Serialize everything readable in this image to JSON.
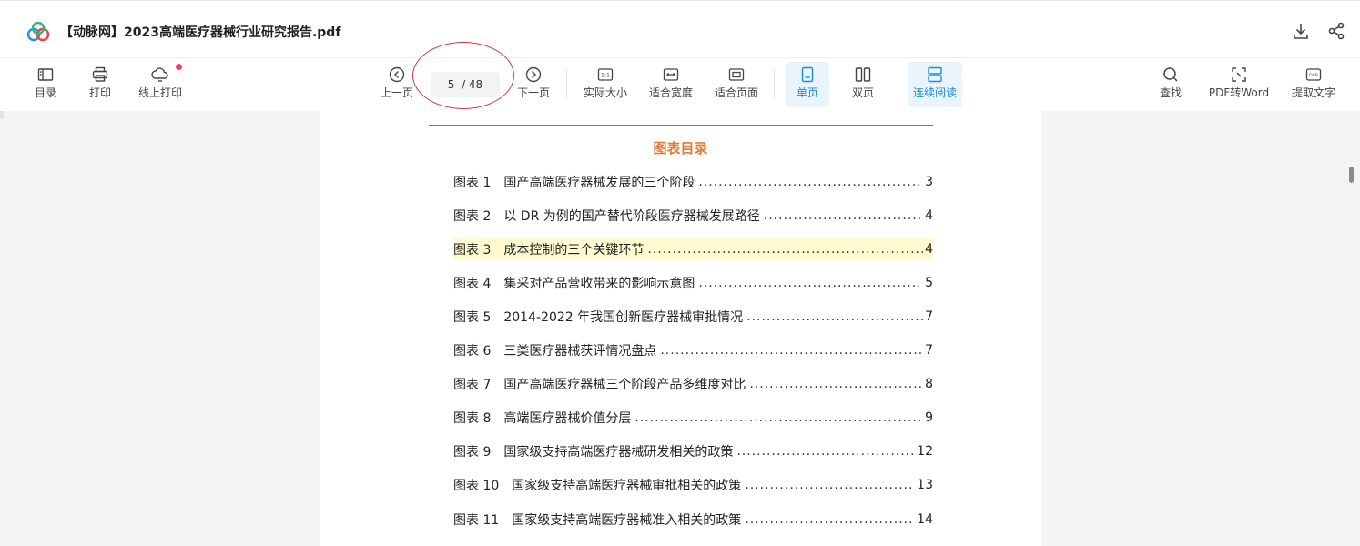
{
  "header": {
    "title": "【动脉网】2023高端医疗器械行业研究报告.pdf",
    "logo_icon": "cloud-logo-icon",
    "actions": [
      {
        "icon": "download-icon"
      },
      {
        "icon": "share-icon"
      }
    ]
  },
  "toolbar": {
    "left": [
      {
        "label": "目录",
        "icon": "toc-icon"
      },
      {
        "label": "打印",
        "icon": "printer-icon"
      },
      {
        "label": "线上打印",
        "icon": "cloud-print-icon"
      }
    ],
    "prev_label": "上一页",
    "next_label": "下一页",
    "page_current": "5",
    "page_total": "/ 48",
    "view": [
      {
        "label": "实际大小",
        "icon": "actual-size-icon"
      },
      {
        "label": "适合宽度",
        "icon": "fit-width-icon"
      },
      {
        "label": "适合页面",
        "icon": "fit-page-icon"
      }
    ],
    "layout": [
      {
        "label": "单页",
        "icon": "single-page-icon",
        "active": true
      },
      {
        "label": "双页",
        "icon": "double-page-icon",
        "active": false
      },
      {
        "label": "连续阅读",
        "icon": "continuous-icon",
        "active": true
      }
    ],
    "right": [
      {
        "label": "查找",
        "icon": "search-icon"
      },
      {
        "label": "PDF转Word",
        "icon": "convert-icon"
      },
      {
        "label": "提取文字",
        "icon": "ocr-icon"
      }
    ],
    "accent_color": "#1e8bd6"
  },
  "document": {
    "toc_title": "图表目录",
    "toc_title_color": "#e07a3a",
    "entries": [
      {
        "label": "图表 1",
        "text": "国产高端医疗器械发展的三个阶段",
        "page": "3"
      },
      {
        "label": "图表 2",
        "text": "以 DR 为例的国产替代阶段医疗器械发展路径",
        "page": "4"
      },
      {
        "label": "图表 3",
        "text": "成本控制的三个关键环节",
        "page": "4",
        "highlight": true
      },
      {
        "label": "图表 4",
        "text": "集采对产品营收带来的影响示意图",
        "page": "5"
      },
      {
        "label": "图表 5",
        "text": "2014-2022 年我国创新医疗器械审批情况",
        "page": "7"
      },
      {
        "label": "图表 6",
        "text": "三类医疗器械获评情况盘点",
        "page": "7"
      },
      {
        "label": "图表 7",
        "text": "国产高端医疗器械三个阶段产品多维度对比",
        "page": "8"
      },
      {
        "label": "图表 8",
        "text": "高端医疗器械价值分层",
        "page": "9"
      },
      {
        "label": "图表 9",
        "text": "国家级支持高端医疗器械研发相关的政策",
        "page": "12"
      },
      {
        "label": "图表 10",
        "text": "国家级支持高端医疗器械审批相关的政策",
        "page": "13"
      },
      {
        "label": "图表 11",
        "text": "国家级支持高端医疗器械准入相关的政策",
        "page": "14"
      }
    ]
  }
}
